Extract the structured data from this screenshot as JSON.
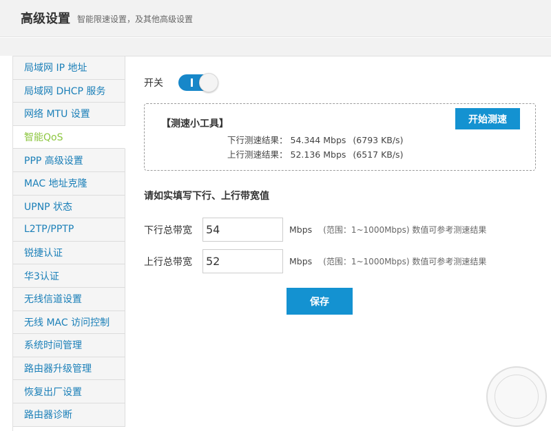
{
  "header": {
    "title": "高级设置",
    "subtitle": "智能限速设置，及其他高级设置"
  },
  "sidebar": {
    "items": [
      {
        "label": "局域网 IP 地址",
        "active": false
      },
      {
        "label": "局域网 DHCP 服务",
        "active": false
      },
      {
        "label": "网络 MTU 设置",
        "active": false
      },
      {
        "label": "智能QoS",
        "active": true
      },
      {
        "label": "PPP 高级设置",
        "active": false
      },
      {
        "label": "MAC 地址克隆",
        "active": false
      },
      {
        "label": "UPNP 状态",
        "active": false
      },
      {
        "label": "L2TP/PPTP",
        "active": false
      },
      {
        "label": "锐捷认证",
        "active": false
      },
      {
        "label": "华3认证",
        "active": false
      },
      {
        "label": "无线信道设置",
        "active": false
      },
      {
        "label": "无线 MAC 访问控制",
        "active": false
      },
      {
        "label": "系统时间管理",
        "active": false
      },
      {
        "label": "路由器升级管理",
        "active": false
      },
      {
        "label": "恢复出厂设置",
        "active": false
      },
      {
        "label": "路由器诊断",
        "active": false
      }
    ]
  },
  "qos": {
    "switch_label": "开关",
    "switch_on": true
  },
  "speedtest": {
    "title": "【测速小工具】",
    "down_label": "下行测速结果：",
    "down_mbps": "54.344 Mbps",
    "down_kbs": "(6793 KB/s)",
    "up_label": "上行测速结果：",
    "up_mbps": "52.136 Mbps",
    "up_kbs": "(6517 KB/s)",
    "start_button": "开始测速"
  },
  "bandwidth": {
    "title": "请如实填写下行、上行带宽值",
    "down_label": "下行总带宽",
    "down_value": "54",
    "up_label": "上行总带宽",
    "up_value": "52",
    "unit": "Mbps",
    "hint": "(范围：1~1000Mbps) 数值可参考测速结果",
    "save_button": "保存"
  },
  "colors": {
    "accent": "#1492d1",
    "active_menu": "#8cc63f",
    "menu_link": "#1a7fb8"
  }
}
